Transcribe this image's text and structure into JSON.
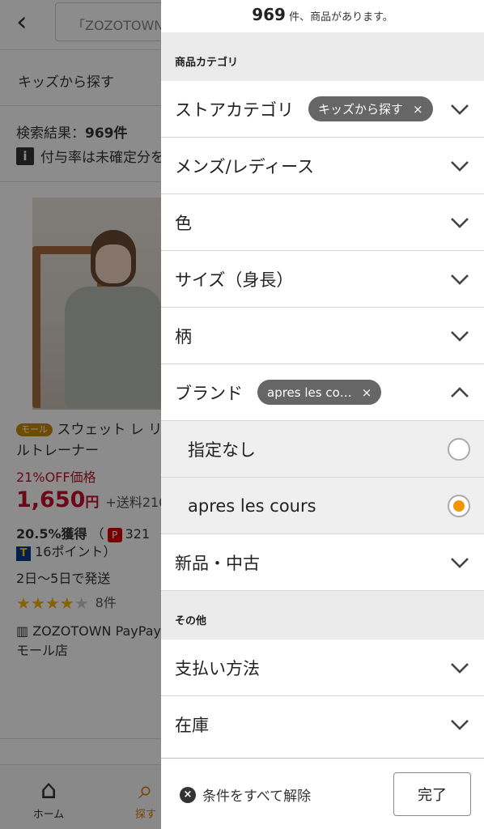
{
  "background": {
    "search_text": "「ZOZOTOWN",
    "breadcrumb": "キッズから探す",
    "result_label": "検索結果：",
    "result_count": "969件",
    "note": "付与率は未確定分を",
    "product": {
      "mall_tag": "モール",
      "name": "スウェット レ リルトレーナー",
      "discount": "21%OFF価格",
      "price": "1,650",
      "yen": "円",
      "shipping": "+送料210",
      "points_rate": "20.5%獲得",
      "points_paren": "（",
      "points_value": "321",
      "t_points": "16ポイント）",
      "ship_days": "2日〜5日で発送",
      "rating_count": "8件",
      "store": "ZOZOTOWN PayPayモール店"
    },
    "tabbar": {
      "home": "ホーム",
      "search": "探す"
    }
  },
  "drawer": {
    "result_count": "969",
    "result_suffix": " 件、商品があります。",
    "section_category": "商品カテゴリ",
    "rows": {
      "store_category": "ストアカテゴリ",
      "store_category_chip": "キッズから探す",
      "gender": "メンズ/レディース",
      "color": "色",
      "size": "サイズ（身長）",
      "pattern": "柄",
      "brand": "ブランド",
      "brand_chip": "apres les co…",
      "condition": "新品・中古"
    },
    "brand_options": {
      "none": "指定なし",
      "apres": "apres les cours",
      "selected": "apres les cours"
    },
    "section_other": "その他",
    "rows_other": {
      "payment": "支払い方法",
      "stock": "在庫"
    },
    "footer": {
      "clear_all": "条件をすべて解除",
      "done": "完了"
    }
  },
  "colors": {
    "accent_orange": "#f29600",
    "price_red": "#c4122f",
    "chip_gray": "#666666"
  }
}
